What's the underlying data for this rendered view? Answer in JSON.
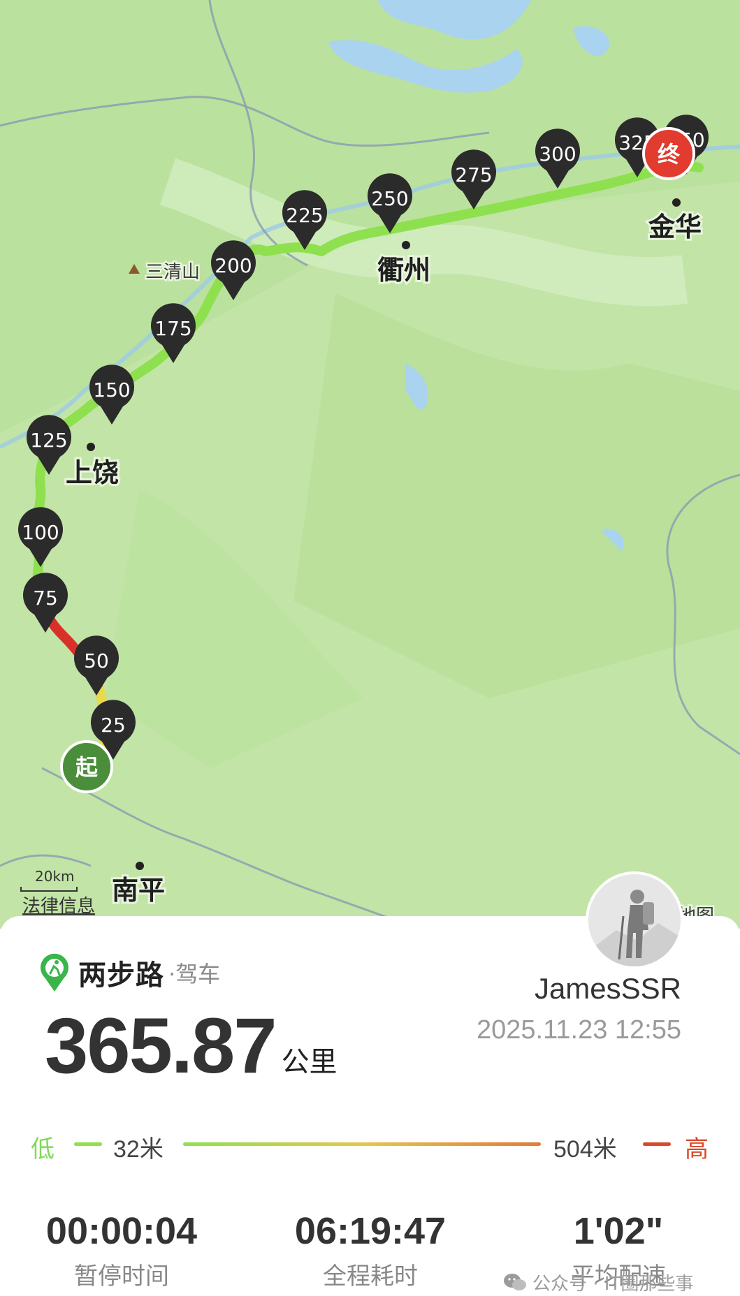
{
  "map": {
    "pins": [
      "25",
      "50",
      "75",
      "100",
      "125",
      "150",
      "175",
      "200",
      "225",
      "250",
      "275",
      "300",
      "325",
      "350"
    ],
    "start_label": "起",
    "end_label": "终",
    "cities": [
      "上饶",
      "衢州",
      "金华",
      "南平"
    ],
    "peak_label": "三清山",
    "scale_text": "20km",
    "legal_link": "法律信息",
    "provider_text": "地图",
    "colors": {
      "water": "#a9d3ef",
      "land": "#bfe4a3",
      "route_low": "#8ee04f",
      "route_high": "#d9312a",
      "start": "#4a8d3a",
      "end": "#e23b2f",
      "pin": "#2b2b2b"
    }
  },
  "card": {
    "brand_name": "两步路",
    "brand_mode": "·驾车",
    "distance_value": "365.87",
    "distance_unit": "公里",
    "username": "JamesSSR",
    "datetime": "2025.11.23 12:55"
  },
  "legend": {
    "low_label": "低",
    "min_value": "32米",
    "max_value": "504米",
    "high_label": "高"
  },
  "stats": [
    {
      "value": "00:00:04",
      "label": "暂停时间"
    },
    {
      "value": "06:19:47",
      "label": "全程耗时"
    },
    {
      "value": "1'02\"",
      "label": "平均配速"
    }
  ],
  "watermark": "公众号 · IT圈那些事"
}
